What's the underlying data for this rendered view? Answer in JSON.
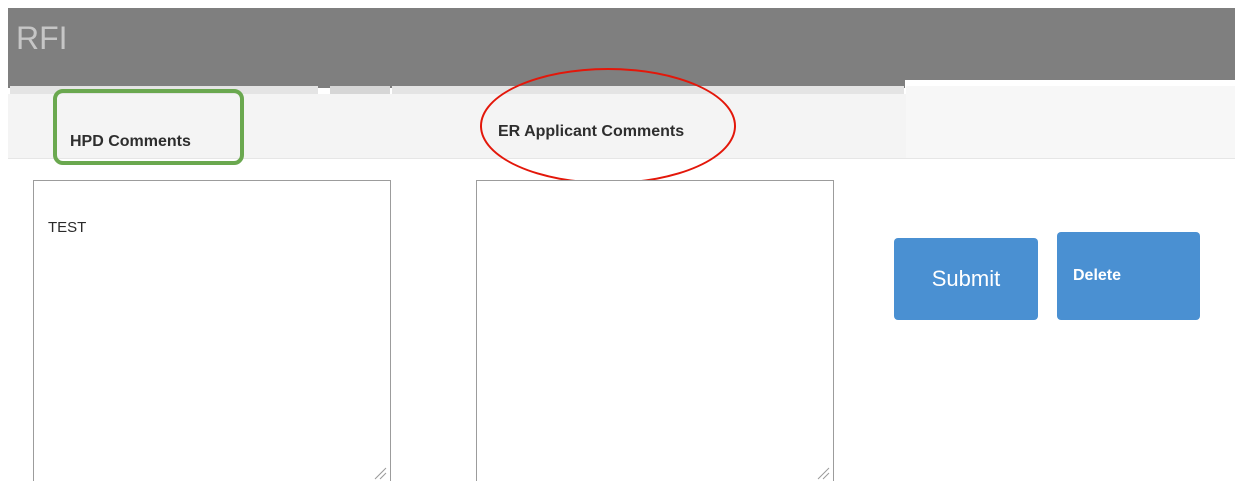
{
  "header": {
    "title": "RFI"
  },
  "hpd": {
    "label": "HPD Comments",
    "value": "TEST",
    "highlight_color": "#6aa84f"
  },
  "er_applicant": {
    "label": "ER Applicant Comments",
    "value": "",
    "highlight_color": "#e3170a"
  },
  "actions": {
    "submit_label": "Submit",
    "delete_label": "Delete",
    "button_color": "#4a90d2"
  },
  "colors": {
    "header_background": "#7f7f7f",
    "header_text": "#c6c6c6"
  },
  "icons": {
    "textarea_resize": "resize-grip-icon"
  }
}
